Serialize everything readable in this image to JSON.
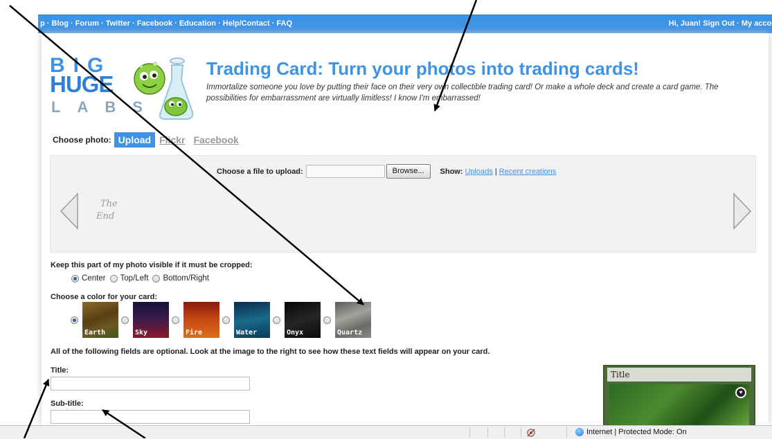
{
  "topbar": {
    "nav": "p · Blog · Forum · Twitter · Facebook · Education · Help/Contact · FAQ",
    "user": "Hi, Juan!  Sign Out · My accou"
  },
  "logo": {
    "line1": "BIG",
    "line2": "HUGE",
    "line3": "LABS"
  },
  "header": {
    "title": "Trading Card: Turn your photos into trading cards!",
    "tagline": "Immortalize someone you love by putting their face on their very own collectible trading card! Or make a whole deck and create a card game. The possibilities for embarrassment are virtually limitless! I know I'm embarrassed!"
  },
  "source": {
    "label": "Choose photo:",
    "tabs": [
      {
        "label": "Upload",
        "active": true
      },
      {
        "label": "Flickr",
        "active": false
      },
      {
        "label": "Facebook",
        "active": false
      }
    ]
  },
  "upload": {
    "choose_label": "Choose a file to upload:",
    "browse_label": "Browse...",
    "show_label": "Show:",
    "uploads_link": "Uploads",
    "separator": "|",
    "recent_link": "Recent creations",
    "carousel_text_1": "The",
    "carousel_text_2": "End"
  },
  "crop": {
    "label": "Keep this part of my photo visible if it must be cropped:",
    "options": [
      {
        "label": "Center",
        "selected": true
      },
      {
        "label": "Top/Left",
        "selected": false
      },
      {
        "label": "Bottom/Right",
        "selected": false
      }
    ]
  },
  "color": {
    "label": "Choose a color for your card:",
    "options": [
      {
        "name": "Earth",
        "selected": true,
        "colors": [
          "#6b4a1c",
          "#9a7a2a",
          "#3f5a1e"
        ]
      },
      {
        "name": "Sky",
        "selected": false,
        "colors": [
          "#1a1a4a",
          "#5a1a4a",
          "#9a1a2a"
        ]
      },
      {
        "name": "Fire",
        "selected": false,
        "colors": [
          "#a8280c",
          "#d4601a",
          "#7a1a08"
        ]
      },
      {
        "name": "Water",
        "selected": false,
        "colors": [
          "#0a3a5a",
          "#1a6a8a",
          "#0a2a4a"
        ]
      },
      {
        "name": "Onyx",
        "selected": false,
        "colors": [
          "#050505",
          "#222222",
          "#0a0a0a"
        ]
      },
      {
        "name": "Quartz",
        "selected": false,
        "colors": [
          "#6a6a68",
          "#9a9a96",
          "#4a4a48"
        ]
      }
    ]
  },
  "fields": {
    "note": "All of the following fields are optional. Look at the image to the right to see how these text fields will appear on your card.",
    "title_label": "Title:",
    "subtitle_label": "Sub-title:"
  },
  "preview": {
    "title": "Title"
  },
  "statusbar": {
    "zone": "Internet | Protected Mode: On"
  }
}
